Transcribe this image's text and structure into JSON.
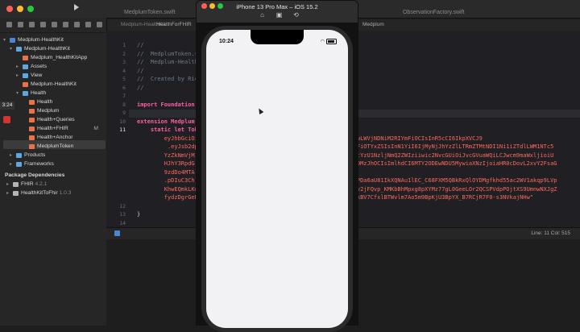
{
  "window": {
    "tabs": [
      "MedplumToken.swift",
      "ObservationFactory.swift"
    ]
  },
  "breadcrumb": [
    "Medplum-HealthKit",
    "HealthForFHIR",
    "Medplum"
  ],
  "navigator": {
    "time_badge": "3:24",
    "items": [
      {
        "label": "Medplum-HealthKit",
        "icon": "project-icon",
        "level": 0,
        "expanded": true
      },
      {
        "label": "Medplum-HealthKit",
        "icon": "folder-icon",
        "level": 1,
        "expanded": true
      },
      {
        "label": "Medplum_HealthKitApp",
        "icon": "swift-file-icon",
        "level": 2
      },
      {
        "label": "Assets",
        "icon": "folder-icon",
        "level": 2,
        "collapsed": true
      },
      {
        "label": "View",
        "icon": "folder-icon",
        "level": 2,
        "collapsed": true
      },
      {
        "label": "Medplum-HealthKit",
        "icon": "file-icon",
        "level": 2
      },
      {
        "label": "Health",
        "icon": "folder-icon",
        "level": 2,
        "expanded": true
      },
      {
        "label": "Health",
        "icon": "swift-file-icon",
        "level": 3
      },
      {
        "label": "Medplum",
        "icon": "swift-file-icon",
        "level": 3
      },
      {
        "label": "Health+Queries",
        "icon": "swift-file-icon",
        "level": 3
      },
      {
        "label": "Health+FHIR",
        "icon": "swift-file-icon",
        "level": 3,
        "badge": "M"
      },
      {
        "label": "Health+Anchor",
        "icon": "swift-file-icon",
        "level": 3
      },
      {
        "label": "MedplumToken",
        "icon": "swift-file-icon",
        "level": 3,
        "selected": true
      },
      {
        "label": "Products",
        "icon": "folder-icon",
        "level": 1,
        "collapsed": true
      },
      {
        "label": "Frameworks",
        "icon": "folder-icon",
        "level": 1,
        "collapsed": true
      }
    ],
    "package_header": "Package Dependencies",
    "packages": [
      {
        "name": "FHIR",
        "version": "4.2.1"
      },
      {
        "name": "HealthKitToFhir",
        "version": "1.0.3"
      }
    ]
  },
  "editor": {
    "line_numbers": [
      "1",
      "2",
      "3",
      "4",
      "5",
      "6",
      "7",
      "8",
      "9",
      "10",
      "11",
      "12",
      "13",
      "14"
    ],
    "current_line": "11",
    "lines": [
      {
        "t": "//",
        "c": "cmt"
      },
      {
        "t": "//  MedplumToken.s",
        "c": "cmt"
      },
      {
        "t": "//  Medplum-Health",
        "c": "cmt"
      },
      {
        "t": "//",
        "c": "cmt"
      },
      {
        "t": "//  Created by Ric",
        "c": "cmt"
      },
      {
        "t": "//",
        "c": "cmt"
      },
      {
        "t": "",
        "c": ""
      },
      {
        "t": "import Foundation",
        "c": "kw"
      },
      {
        "t": "",
        "c": ""
      },
      {
        "t": "extension Medplum",
        "c": "kw"
      },
      {
        "t": "    static let Tok",
        "c": "kw"
      }
    ],
    "token_lines": [
      "        eyJhbGciOi",
      "         .eyJsb2dp",
      "        YzZkNmVjM",
      "        HJhY3RpdG",
      "        9zdDo4MTA",
      "        .pDIuC3Ch",
      "        KhwEQmkLKw",
      "        fydzDgrGeP"
    ],
    "token_tail": [
      "iMmEwLWVjNDNiM2RIYmFiOCIsInR5cCI6IkpXVCJ9",
      "g3OWFiOTYxZSIsInN1YiI6IjMyNjJhYzZlLTRmZTMtNDI1Ni1iZTdlLWM1NTc5",
      "iN2UtYzU1NzljNmQ2ZWIziiwic2NvcGUiOiJvcGVuaWQiLCJwcm9maWxljioiU",
      "3NDQ0MzJhOCIsImlhdCI6MTY2ODEwNDU5MywiaXNzIjoiaHR0cDovL2xvY2FsaG",
      "",
      "2s6-PDa6aU81IkXQNAu1lEC_C68FXM5QBkRxQlOYDMgfkhd55ac2WV1akqp9LVp",
      "XpL1v2jFQvp_KMKbBhMpxg8pXYMz77gL0GeeLOr2QCSPVdpPOjtXS9UmnwNXJgZ",
      "xYgRkBV7CfxlBTWvlm7Ao5m9BpKjU3BpYX_B7RCjR7F0-s3NVkajNHw\""
    ],
    "closing": "}"
  },
  "status": {
    "line_col": "Line: 11  Col: 515"
  },
  "simulator": {
    "title": "iPhone 13 Pro Max – iOS 15.2",
    "status_time": "10:24"
  }
}
